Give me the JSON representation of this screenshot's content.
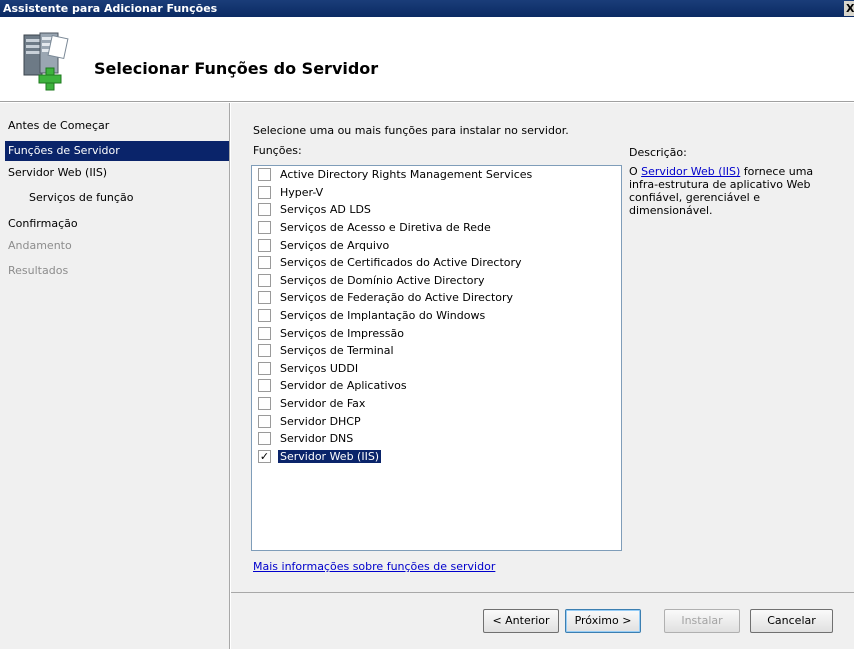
{
  "window": {
    "title": "Assistente para Adicionar Funções",
    "close_glyph": "X"
  },
  "header": {
    "title": "Selecionar Funções do Servidor",
    "icon": "server-add-icon"
  },
  "sidebar": {
    "items": [
      {
        "label": "Antes de Começar",
        "state": "normal"
      },
      {
        "label": "Funções de Servidor",
        "state": "active"
      },
      {
        "label": "Servidor Web (IIS)",
        "state": "normal"
      },
      {
        "label": "Serviços de função",
        "state": "sub"
      },
      {
        "label": "Confirmação",
        "state": "normal"
      },
      {
        "label": "Andamento",
        "state": "disabled"
      },
      {
        "label": "Resultados",
        "state": "disabled"
      }
    ]
  },
  "main": {
    "instruction": "Selecione uma ou mais funções para instalar no servidor.",
    "roles_label": "Funções:",
    "roles": [
      {
        "label": "Active Directory Rights Management Services",
        "checked": false
      },
      {
        "label": "Hyper-V",
        "checked": false
      },
      {
        "label": "Serviços AD LDS",
        "checked": false
      },
      {
        "label": "Serviços de Acesso e Diretiva de Rede",
        "checked": false
      },
      {
        "label": "Serviços de Arquivo",
        "checked": false
      },
      {
        "label": "Serviços de Certificados do Active Directory",
        "checked": false
      },
      {
        "label": "Serviços de Domínio Active Directory",
        "checked": false
      },
      {
        "label": "Serviços de Federação do Active Directory",
        "checked": false
      },
      {
        "label": "Serviços de Implantação do Windows",
        "checked": false
      },
      {
        "label": "Serviços de Impressão",
        "checked": false
      },
      {
        "label": "Serviços de Terminal",
        "checked": false
      },
      {
        "label": "Serviços UDDI",
        "checked": false
      },
      {
        "label": "Servidor de Aplicativos",
        "checked": false
      },
      {
        "label": "Servidor de Fax",
        "checked": false
      },
      {
        "label": "Servidor DHCP",
        "checked": false
      },
      {
        "label": "Servidor DNS",
        "checked": false
      },
      {
        "label": "Servidor Web (IIS)",
        "checked": true
      }
    ],
    "more_info_link": "Mais informações sobre funções de servidor",
    "description": {
      "label": "Descrição:",
      "prefix": "O ",
      "link": "Servidor Web (IIS)",
      "suffix": " fornece uma infra-estrutura de aplicativo Web confiável, gerenciável e dimensionável."
    }
  },
  "buttons": {
    "previous": "< Anterior",
    "next": "Próximo >",
    "install": "Instalar",
    "cancel": "Cancelar"
  },
  "colors": {
    "titlebar": "#0b2a63",
    "selection": "#0a246a",
    "link": "#0000cc",
    "panel": "#f0f0f0"
  }
}
